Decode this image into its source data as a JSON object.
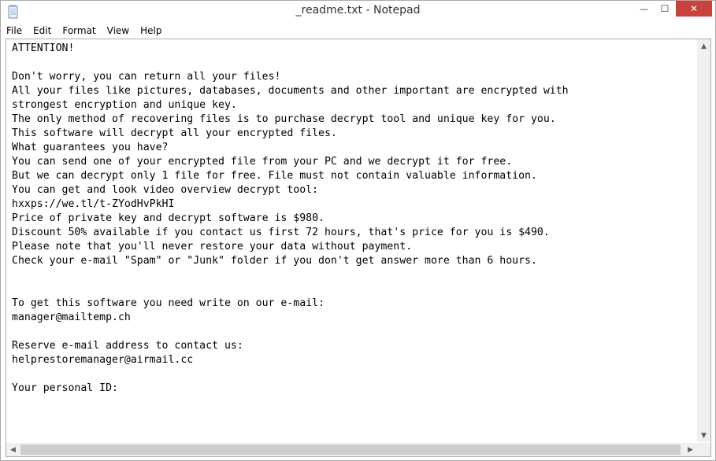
{
  "window": {
    "title": "_readme.txt - Notepad",
    "buttons": {
      "minimize": "—",
      "maximize": "☐",
      "close": "✕"
    }
  },
  "menu": {
    "items": [
      "File",
      "Edit",
      "Format",
      "View",
      "Help"
    ]
  },
  "document": {
    "lines": [
      "ATTENTION!",
      "",
      "Don't worry, you can return all your files!",
      "All your files like pictures, databases, documents and other important are encrypted with",
      "strongest encryption and unique key.",
      "The only method of recovering files is to purchase decrypt tool and unique key for you.",
      "This software will decrypt all your encrypted files.",
      "What guarantees you have?",
      "You can send one of your encrypted file from your PC and we decrypt it for free.",
      "But we can decrypt only 1 file for free. File must not contain valuable information.",
      "You can get and look video overview decrypt tool:",
      "hxxps://we.tl/t-ZYodHvPkHI",
      "Price of private key and decrypt software is $980.",
      "Discount 50% available if you contact us first 72 hours, that's price for you is $490.",
      "Please note that you'll never restore your data without payment.",
      "Check your e-mail \"Spam\" or \"Junk\" folder if you don't get answer more than 6 hours.",
      "",
      "",
      "To get this software you need write on our e-mail:",
      "manager@mailtemp.ch",
      "",
      "Reserve e-mail address to contact us:",
      "helprestoremanager@airmail.cc",
      "",
      "Your personal ID:"
    ]
  },
  "scrollbars": {
    "up_arrow": "▲",
    "down_arrow": "▼",
    "left_arrow": "◀",
    "right_arrow": "▶"
  }
}
